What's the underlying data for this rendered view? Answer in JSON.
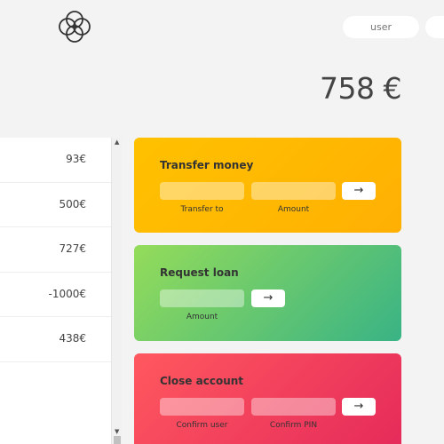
{
  "header": {
    "logo_icon": "four-circles-logo-icon",
    "login_user_placeholder": "user",
    "login_pin_placeholder": ""
  },
  "balance": {
    "value": "758 €"
  },
  "movements": {
    "rows": [
      {
        "value": "93€"
      },
      {
        "value": "500€"
      },
      {
        "value": "727€"
      },
      {
        "value": "-1000€"
      },
      {
        "value": "438€"
      },
      {
        "value": ""
      }
    ]
  },
  "operations": {
    "transfer": {
      "title": "Transfer money",
      "label_1": "Transfer to",
      "label_2": "Amount",
      "button": "→",
      "color_start": "#ffc100",
      "color_end": "#ffb003"
    },
    "loan": {
      "title": "Request loan",
      "label_1": "Amount",
      "button": "→",
      "color_start": "#94dc5a",
      "color_end": "#39b385"
    },
    "close": {
      "title": "Close account",
      "label_1": "Confirm user",
      "label_2": "Confirm PIN",
      "button": "→",
      "color_start": "#ff585f",
      "color_end": "#e52a5a"
    }
  }
}
